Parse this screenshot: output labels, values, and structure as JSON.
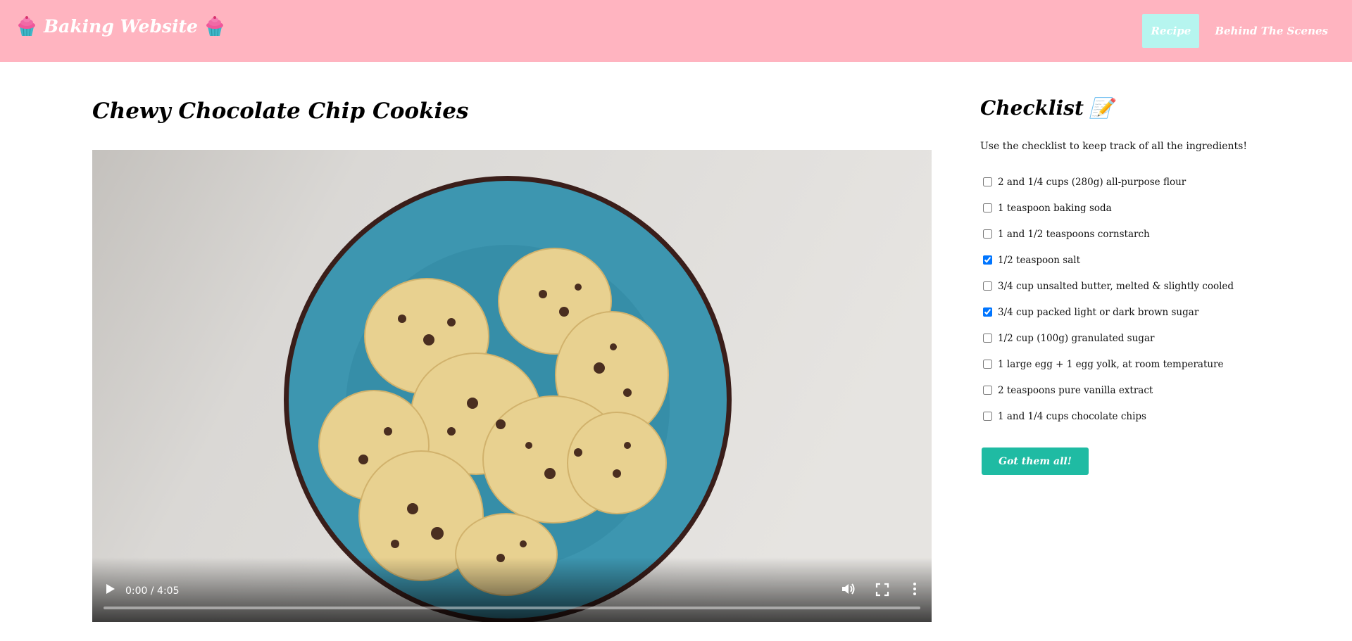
{
  "header": {
    "brand": "Baking Website",
    "nav": [
      {
        "label": "Recipe",
        "active": true
      },
      {
        "label": "Behind The Scenes",
        "active": false
      }
    ],
    "colors": {
      "navbar": "#ffb4c0",
      "active_tab": "#b6f5ef"
    }
  },
  "main": {
    "title": "Chewy Chocolate Chip Cookies",
    "video": {
      "time": "0:00 / 4:05",
      "progress": 0,
      "icons": [
        "play-icon",
        "volume-icon",
        "fullscreen-icon",
        "more-options-icon"
      ]
    }
  },
  "checklist": {
    "title": "Checklist",
    "emoji": "📝",
    "intro": "Use the checklist to keep track of all the ingredients!",
    "items": [
      {
        "label": "2 and 1/4 cups (280g) all-purpose flour",
        "checked": false
      },
      {
        "label": "1 teaspoon baking soda",
        "checked": false
      },
      {
        "label": "1 and 1/2 teaspoons cornstarch",
        "checked": false
      },
      {
        "label": "1/2 teaspoon salt",
        "checked": true
      },
      {
        "label": "3/4 cup unsalted butter, melted & slightly cooled",
        "checked": false
      },
      {
        "label": "3/4 cup packed light or dark brown sugar",
        "checked": true
      },
      {
        "label": "1/2 cup (100g) granulated sugar",
        "checked": false
      },
      {
        "label": "1 large egg + 1 egg yolk, at room temperature",
        "checked": false
      },
      {
        "label": "2 teaspoons pure vanilla extract",
        "checked": false
      },
      {
        "label": "1 and 1/4 cups chocolate chips",
        "checked": false
      }
    ],
    "button_label": "Got them all!",
    "button_color": "#1fbba3"
  }
}
